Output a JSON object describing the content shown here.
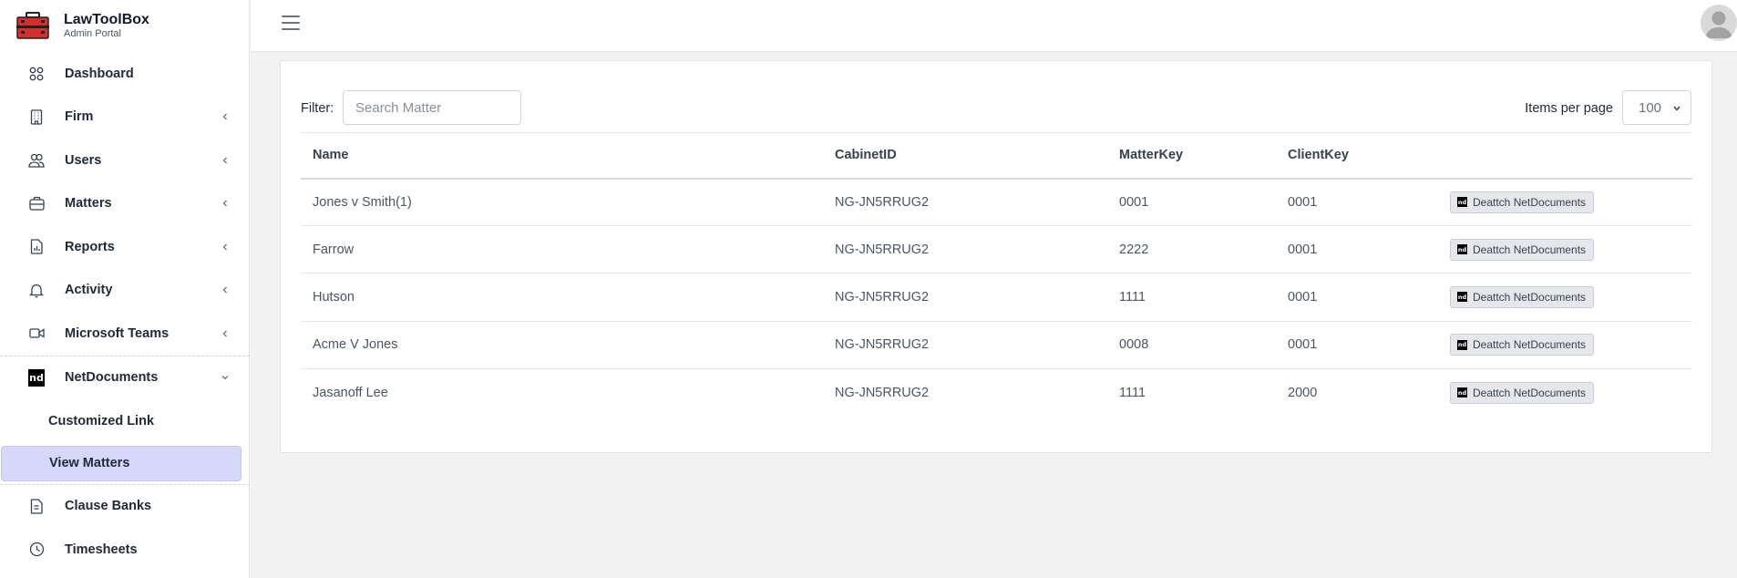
{
  "brand": {
    "title": "LawToolBox",
    "subtitle": "Admin Portal"
  },
  "sidebar": {
    "items": [
      {
        "label": "Dashboard",
        "icon": "grid-icon",
        "chevron": false
      },
      {
        "label": "Firm",
        "icon": "building-icon",
        "chevron": true
      },
      {
        "label": "Users",
        "icon": "users-icon",
        "chevron": true
      },
      {
        "label": "Matters",
        "icon": "briefcase-icon",
        "chevron": true
      },
      {
        "label": "Reports",
        "icon": "report-icon",
        "chevron": true
      },
      {
        "label": "Activity",
        "icon": "bell-icon",
        "chevron": true
      },
      {
        "label": "Microsoft Teams",
        "icon": "video-icon",
        "chevron": true
      },
      {
        "label": "NetDocuments",
        "icon": "nd-icon",
        "icon_text": "nd",
        "chevron": true,
        "expanded": true
      },
      {
        "label": "Clause Banks",
        "icon": "document-icon",
        "chevron": false
      },
      {
        "label": "Timesheets",
        "icon": "clock-icon",
        "chevron": false
      }
    ],
    "netdocuments_sub": [
      {
        "label": "Customized Link",
        "active": false
      },
      {
        "label": "View Matters",
        "active": true
      }
    ]
  },
  "filter": {
    "label": "Filter:",
    "placeholder": "Search Matter",
    "value": ""
  },
  "pagination": {
    "label": "Items per page",
    "selected": "100"
  },
  "table": {
    "columns": [
      "Name",
      "CabinetID",
      "MatterKey",
      "ClientKey",
      ""
    ],
    "rows": [
      {
        "name": "Jones v Smith(1)",
        "cabinet": "NG-JN5RRUG2",
        "matter": "0001",
        "client": "0001",
        "action": "Deattch NetDocuments"
      },
      {
        "name": "Farrow",
        "cabinet": "NG-JN5RRUG2",
        "matter": "2222",
        "client": "0001",
        "action": "Deattch NetDocuments"
      },
      {
        "name": "Hutson",
        "cabinet": "NG-JN5RRUG2",
        "matter": "1111",
        "client": "0001",
        "action": "Deattch NetDocuments"
      },
      {
        "name": "Acme V Jones",
        "cabinet": "NG-JN5RRUG2",
        "matter": "0008",
        "client": "0001",
        "action": "Deattch NetDocuments"
      },
      {
        "name": "Jasanoff Lee",
        "cabinet": "NG-JN5RRUG2",
        "matter": "1111",
        "client": "2000",
        "action": "Deattch NetDocuments"
      }
    ],
    "action_icon_text": "nd"
  },
  "colors": {
    "active_bg": "#d5d8f8",
    "logo_red": "#d32f2f",
    "page_bg": "#f2f2f2"
  }
}
